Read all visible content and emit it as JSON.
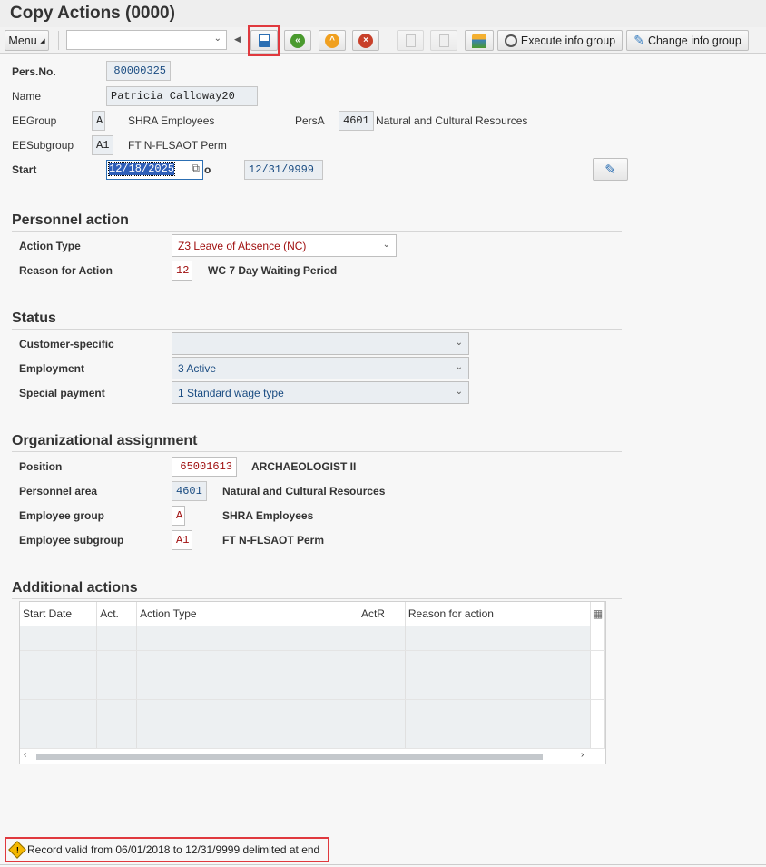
{
  "title": "Copy Actions (0000)",
  "toolbar": {
    "menu": "Menu",
    "command_value": "",
    "execute": "Execute info group",
    "change": "Change info group"
  },
  "header": {
    "persno_label": "Pers.No.",
    "persno": "80000325",
    "name_label": "Name",
    "name": "Patricia Calloway20",
    "eegroup_label": "EEGroup",
    "eegroup": "A",
    "eegroup_text": "SHRA Employees",
    "persa_label": "PersA",
    "persa": "4601",
    "persa_text": "Natural and Cultural Resources",
    "eesub_label": "EESubgroup",
    "eesub": "A1",
    "eesub_text": "FT N-FLSAOT Perm",
    "start_label": "Start",
    "start": "12/18/2025",
    "to_label": "o",
    "end": "12/31/9999"
  },
  "personnel_action": {
    "heading": "Personnel action",
    "action_type_label": "Action Type",
    "action_type": "Z3 Leave of Absence (NC)",
    "reason_label": "Reason for Action",
    "reason_code": "12",
    "reason_text": "WC 7 Day Waiting Period"
  },
  "status": {
    "heading": "Status",
    "customer_label": "Customer-specific",
    "customer": "",
    "employment_label": "Employment",
    "employment": "3 Active",
    "special_label": "Special payment",
    "special": "1 Standard wage type"
  },
  "org": {
    "heading": "Organizational assignment",
    "position_label": "Position",
    "position": "65001613",
    "position_text": "ARCHAEOLOGIST II",
    "parea_label": "Personnel area",
    "parea": "4601",
    "parea_text": "Natural and Cultural Resources",
    "egroup_label": "Employee group",
    "egroup": "A",
    "egroup_text": "SHRA Employees",
    "esub_label": "Employee subgroup",
    "esub": "A1",
    "esub_text": "FT N-FLSAOT Perm"
  },
  "additional": {
    "heading": "Additional actions",
    "columns": [
      "Start Date",
      "Act.",
      "Action Type",
      "ActR",
      "Reason for action"
    ]
  },
  "statusbar": {
    "message": "Record valid from 06/01/2018 to 12/31/9999 delimited at end"
  }
}
